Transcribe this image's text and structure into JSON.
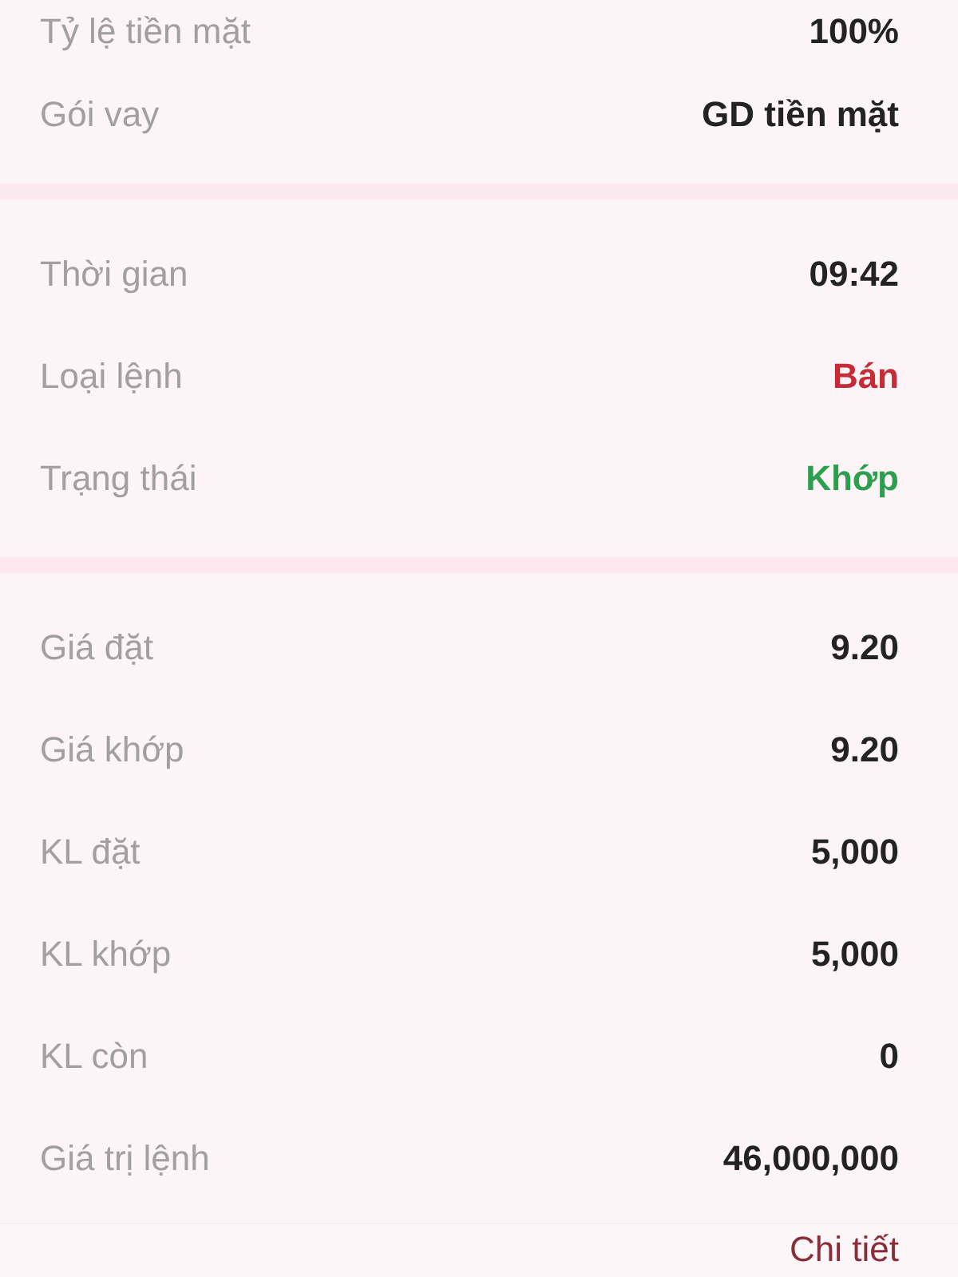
{
  "sections": [
    {
      "rows": [
        {
          "label": "Tỷ lệ tiền mặt",
          "value": "100%"
        },
        {
          "label": "Gói vay",
          "value": "GD tiền mặt"
        }
      ]
    },
    {
      "rows": [
        {
          "label": "Thời gian",
          "value": "09:42"
        },
        {
          "label": "Loại lệnh",
          "value": "Bán",
          "color": "#c62b36"
        },
        {
          "label": "Trạng thái",
          "value": "Khớp",
          "color": "#2e9e4f"
        }
      ]
    },
    {
      "rows": [
        {
          "label": "Giá đặt",
          "value": "9.20"
        },
        {
          "label": "Giá khớp",
          "value": "9.20"
        },
        {
          "label": "KL đặt",
          "value": "5,000"
        },
        {
          "label": "KL khớp",
          "value": "5,000"
        },
        {
          "label": "KL còn",
          "value": "0"
        },
        {
          "label": "Giá trị lệnh",
          "value": "46,000,000"
        }
      ]
    }
  ],
  "detail_link": "Chi tiết"
}
